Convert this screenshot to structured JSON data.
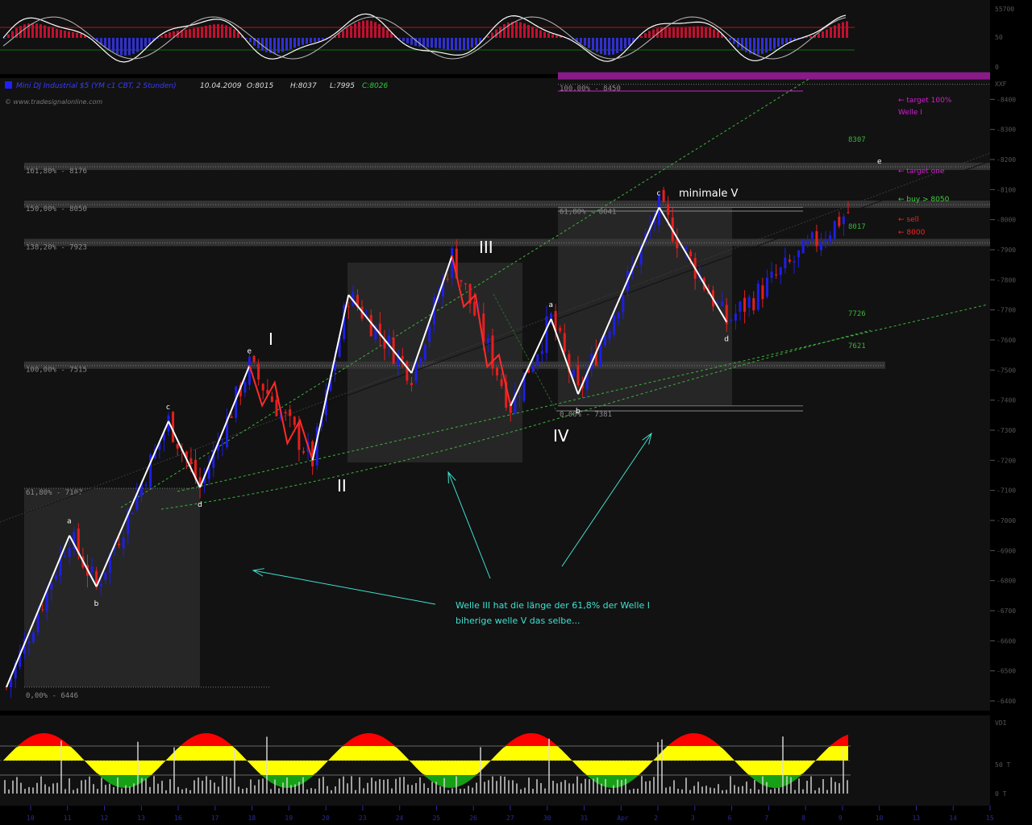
{
  "header": {
    "instrument": "Mini DJ Industrial $5 (YM c1 CBT, 2 Stunden)",
    "date": "10.04.2009",
    "open": "O:8015",
    "high": "H:8037",
    "low": "L:7995",
    "close": "C:8026",
    "watermark": "© www.tradesignalonline.com"
  },
  "colors": {
    "background": "#000000",
    "panel": "#141414",
    "bull": "#1e1ee6",
    "bear": "#e61e1e",
    "wave": "#ffffff",
    "annotation": "#40e0d0",
    "guide_green": "#3cb43c",
    "target_magenta": "#d020d0",
    "indicator_yellow": "#ffff00",
    "indicator_red": "#ff0000",
    "indicator_green": "#16a016"
  },
  "chart_data": [
    {
      "panel": "top-oscillator",
      "type": "line",
      "axis_ticks": [
        "55700",
        "50",
        "0"
      ],
      "levels": [
        50
      ]
    },
    {
      "panel": "main",
      "type": "candlestick",
      "ylim": [
        6400,
        8500
      ],
      "y_ticks": [
        8400,
        8300,
        8200,
        8100,
        8000,
        7900,
        7800,
        7700,
        7600,
        7500,
        7400,
        7300,
        7200,
        7100,
        7000,
        6900,
        6800,
        6700,
        6600,
        6500,
        6400
      ],
      "y_axis_label": "XXF",
      "x_ticks": [
        "10",
        "11",
        "12",
        "13",
        "16",
        "17",
        "18",
        "19",
        "20",
        "23",
        "24",
        "25",
        "26",
        "27",
        "30",
        "31",
        "Apr",
        "2",
        "3",
        "6",
        "7",
        "8",
        "9",
        "10",
        "13",
        "14",
        "15"
      ],
      "fib_levels": [
        {
          "label": "0,00% - 6446",
          "value": 6446
        },
        {
          "label": "61,80% - 7107",
          "value": 7107
        },
        {
          "label": "100,00% - 7515",
          "value": 7515
        },
        {
          "label": "138,20% - 7923",
          "value": 7923
        },
        {
          "label": "150,00% - 8050",
          "value": 8050
        },
        {
          "label": "161,80% - 8176",
          "value": 8176
        },
        {
          "label": "0,00% - 7381",
          "value": 7381
        },
        {
          "label": "61,80% - 8041",
          "value": 8041
        },
        {
          "label": "100,00% - 8450",
          "value": 8450
        }
      ],
      "price_marks": [
        {
          "label": "8307",
          "value": 8307
        },
        {
          "label": "8017",
          "value": 8017
        },
        {
          "label": "7726",
          "value": 7726
        },
        {
          "label": "7621",
          "value": 7621
        }
      ],
      "wave_labels": [
        "I",
        "II",
        "III",
        "IV",
        "minimale V"
      ],
      "subwave_labels": [
        "a",
        "b",
        "c",
        "d",
        "e"
      ],
      "side_notes": [
        "← target 100%",
        "Welle I",
        "← target one",
        "← buy > 8050",
        "← sell",
        "← 8000"
      ],
      "annotation": [
        "Welle III hat die länge der 61,8% der Welle I",
        "biherige welle V das selbe..."
      ],
      "wave_pivots": [
        {
          "bar": 0,
          "value": 6446,
          "label": ""
        },
        {
          "bar": 14,
          "value": 6950,
          "label": "a"
        },
        {
          "bar": 20,
          "value": 6780,
          "label": "b"
        },
        {
          "bar": 36,
          "value": 7330,
          "label": "c"
        },
        {
          "bar": 43,
          "value": 7110,
          "label": "d"
        },
        {
          "bar": 54,
          "value": 7515,
          "label": "e"
        },
        {
          "bar": 68,
          "value": 7200,
          "label": ""
        },
        {
          "bar": 76,
          "value": 7750,
          "label": ""
        },
        {
          "bar": 90,
          "value": 7490,
          "label": ""
        },
        {
          "bar": 99,
          "value": 7880,
          "label": ""
        },
        {
          "bar": 112,
          "value": 7381,
          "label": ""
        },
        {
          "bar": 121,
          "value": 7670,
          "label": "a"
        },
        {
          "bar": 127,
          "value": 7420,
          "label": "b"
        },
        {
          "bar": 145,
          "value": 8041,
          "label": "c"
        },
        {
          "bar": 160,
          "value": 7660,
          "label": "d"
        }
      ],
      "candles_close_end": 8026
    },
    {
      "panel": "bottom-oscillator",
      "type": "area",
      "axis_ticks": [
        "VDI",
        "50 T",
        "0 T"
      ]
    }
  ]
}
